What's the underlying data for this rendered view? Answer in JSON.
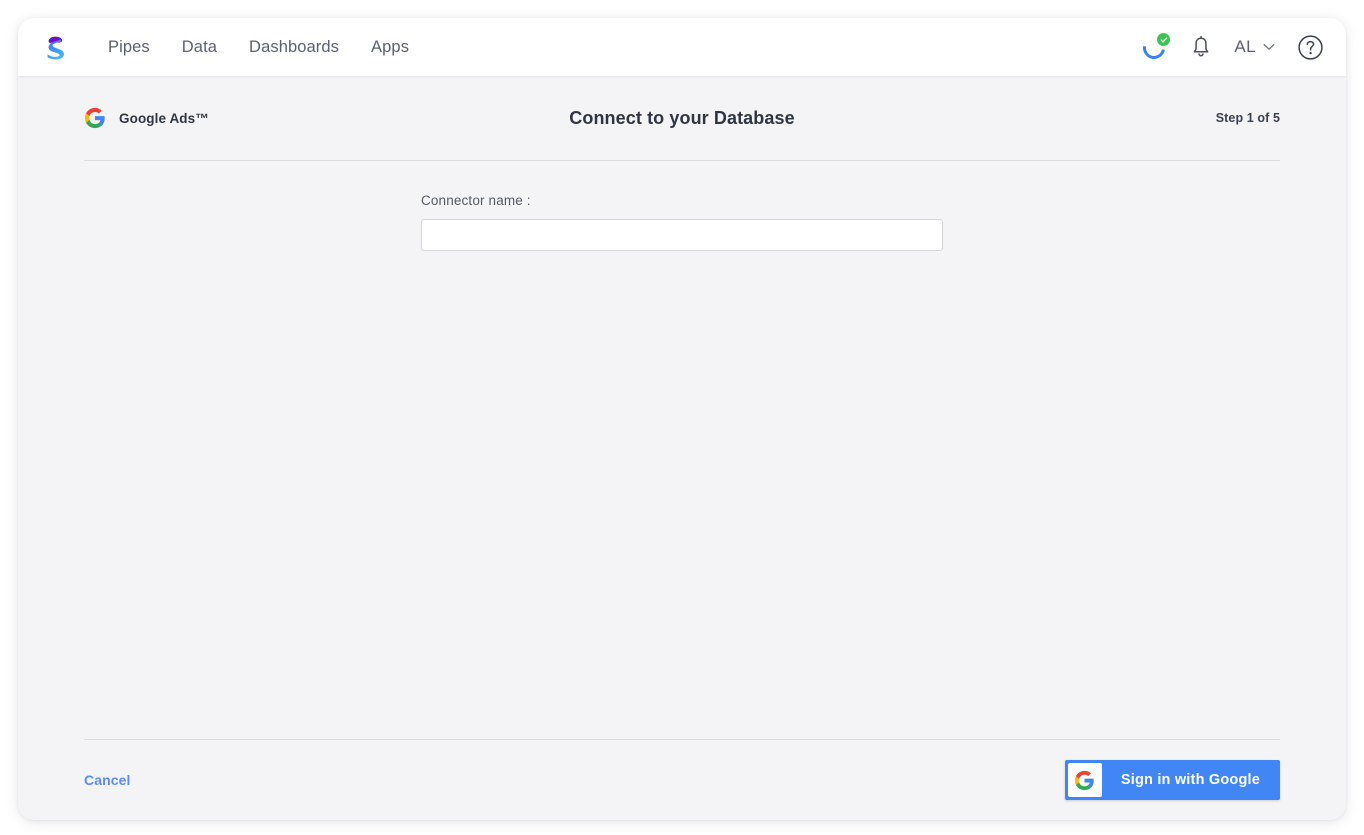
{
  "app": {
    "logo_icon": "sprinklr-s-logo",
    "logo_colors": {
      "top": "#6d10c9",
      "body_start": "#4b7bf5",
      "body_end": "#41b6f0"
    }
  },
  "nav": {
    "links": [
      {
        "label": "Pipes",
        "name": "nav-link-pipes"
      },
      {
        "label": "Data",
        "name": "nav-link-data"
      },
      {
        "label": "Dashboards",
        "name": "nav-link-dashboards"
      },
      {
        "label": "Apps",
        "name": "nav-link-apps"
      }
    ],
    "right": {
      "sync_icon": "sync-status-icon",
      "sync_badge_icon": "check-badge-icon",
      "sync_ring_color": "#3b82f6",
      "sync_badge_color": "#3ec451",
      "notifications_icon": "bell-icon",
      "user_initials": "AL",
      "user_chevron_icon": "chevron-down-icon",
      "help_icon": "question-circle-icon"
    }
  },
  "wizard": {
    "source_logo_icon": "google-g-icon",
    "source_name": "Google Ads™",
    "title": "Connect to your Database",
    "step_text": "Step 1 of 5",
    "form": {
      "connector_name_label": "Connector name :",
      "connector_name_value": "",
      "connector_name_placeholder": ""
    },
    "footer": {
      "cancel_label": "Cancel",
      "cancel_color": "#5b8def",
      "signin_label": "Sign in with Google",
      "signin_icon": "google-g-icon",
      "signin_bg": "#4285f4"
    }
  }
}
